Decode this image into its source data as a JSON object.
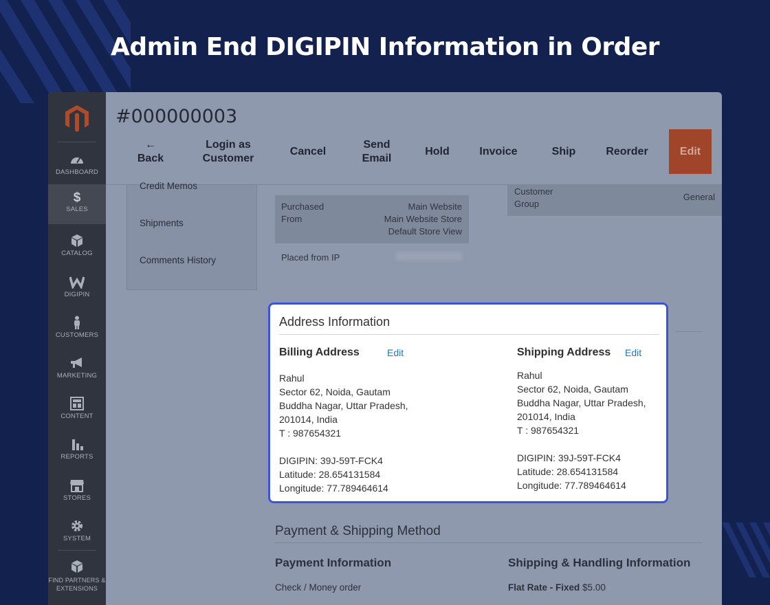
{
  "headline": "Admin End DIGIPIN Information in Order",
  "colors": {
    "accent": "#3a55d6",
    "edit_button": "#a0452a",
    "link": "#1979c3",
    "background": "#13214f"
  },
  "order": {
    "number": "#000000003"
  },
  "sidebar": {
    "items": [
      {
        "label": "DASHBOARD",
        "icon": "dashboard-icon"
      },
      {
        "label": "SALES",
        "icon": "dollar-icon"
      },
      {
        "label": "CATALOG",
        "icon": "catalog-box-icon"
      },
      {
        "label": "DIGIPIN",
        "icon": "digipin-w-icon"
      },
      {
        "label": "CUSTOMERS",
        "icon": "person-icon"
      },
      {
        "label": "MARKETING",
        "icon": "megaphone-icon"
      },
      {
        "label": "CONTENT",
        "icon": "content-layout-icon"
      },
      {
        "label": "REPORTS",
        "icon": "bar-chart-icon"
      },
      {
        "label": "STORES",
        "icon": "store-icon"
      },
      {
        "label": "SYSTEM",
        "icon": "gear-icon"
      },
      {
        "label": "FIND PARTNERS & EXTENSIONS",
        "icon": "partners-box-icon"
      }
    ]
  },
  "toolbar": {
    "back_arrow": "←",
    "back": "Back",
    "login_as_1": "Login as",
    "login_as_2": "Customer",
    "cancel": "Cancel",
    "send_1": "Send",
    "send_2": "Email",
    "hold": "Hold",
    "invoice": "Invoice",
    "ship": "Ship",
    "reorder": "Reorder",
    "edit": "Edit"
  },
  "left_panel": {
    "items": [
      "Credit Memos",
      "Shipments",
      "Comments History"
    ]
  },
  "order_info": {
    "purchased_from_label_1": "Purchased",
    "purchased_from_label_2": "From",
    "purchased_from_values": [
      "Main Website",
      "Main Website Store",
      "Default Store View"
    ],
    "placed_from_ip_label": "Placed from IP"
  },
  "customer": {
    "group_label_1": "Customer",
    "group_label_2": "Group",
    "group_value": "General"
  },
  "address_info": {
    "title": "Address Information",
    "billing": {
      "heading": "Billing Address",
      "edit": "Edit",
      "lines": [
        "Rahul",
        "Sector 62, Noida, Gautam",
        "Buddha Nagar, Uttar Pradesh,",
        "201014, India",
        "T : 987654321"
      ],
      "digipin": "DIGIPIN: 39J-59T-FCK4",
      "latitude": "Latitude: 28.654131584",
      "longitude": "Longitude: 77.789464614"
    },
    "shipping": {
      "heading": "Shipping Address",
      "edit": "Edit",
      "lines": [
        "Rahul",
        "Sector 62, Noida, Gautam",
        "Buddha Nagar, Uttar Pradesh,",
        "201014, India",
        "T : 987654321"
      ],
      "digipin": "DIGIPIN: 39J-59T-FCK4",
      "latitude": "Latitude: 28.654131584",
      "longitude": "Longitude: 77.789464614"
    }
  },
  "payment_shipping": {
    "title": "Payment & Shipping Method",
    "payment_title": "Payment Information",
    "payment_method": "Check / Money order",
    "shipping_title": "Shipping & Handling Information",
    "shipping_method": "Flat Rate - Fixed",
    "shipping_price": "$5.00"
  }
}
